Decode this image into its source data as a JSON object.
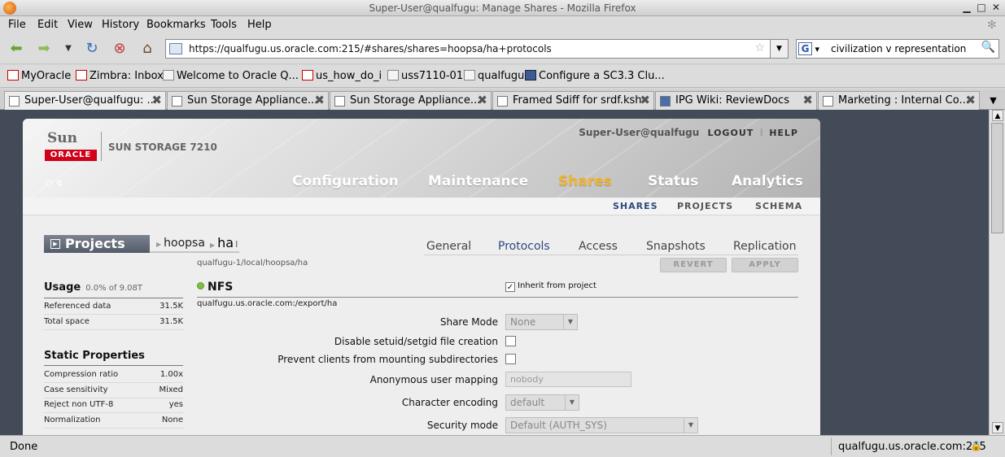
{
  "window": {
    "title": "Super-User@qualfugu: Manage Shares - Mozilla Firefox"
  },
  "menu": [
    "File",
    "Edit",
    "View",
    "History",
    "Bookmarks",
    "Tools",
    "Help"
  ],
  "nav": {
    "url": "https://qualfugu.us.oracle.com:215/#shares/shares=hoopsa/ha+protocols",
    "search_value": "civilization v representation",
    "search_engine": "G"
  },
  "bookmarks": [
    "MyOracle",
    "Zimbra: Inbox",
    "Welcome to Oracle Q...",
    "us_how_do_i",
    "uss7110-01",
    "qualfugu",
    "Configure a SC3.3 Clu..."
  ],
  "tabs": [
    "Super-User@qualfugu: ...",
    "Sun Storage Appliance...",
    "Sun Storage Appliance...",
    "Framed Sdiff for srdf.ksh",
    "IPG Wiki: ReviewDocs",
    "Marketing : Internal Co..."
  ],
  "status": {
    "left": "Done",
    "host": "qualfugu.us.oracle.com:215"
  },
  "app": {
    "logo_sun": "Sun",
    "logo_oracle": "ORACLE",
    "product": "SUN STORAGE 7210",
    "user": "Super-User@qualfugu",
    "logout": "LOGOUT",
    "help": "HELP",
    "main_nav": [
      "Configuration",
      "Maintenance",
      "Shares",
      "Status",
      "Analytics"
    ],
    "main_nav_selected": "Shares",
    "sub_nav": [
      "SHARES",
      "PROJECTS",
      "SCHEMA"
    ],
    "sub_nav_selected": "SHARES",
    "projects_label": "Projects",
    "breadcrumb": {
      "project": "hoopsa",
      "share": "ha"
    },
    "path": "qualfugu-1/local/hoopsa/ha",
    "page_tabs": [
      "General",
      "Protocols",
      "Access",
      "Snapshots",
      "Replication"
    ],
    "page_tab_selected": "Protocols",
    "buttons": {
      "revert": "REVERT",
      "apply": "APPLY"
    },
    "usage": {
      "title": "Usage",
      "summary": "0.0% of 9.08T",
      "rows": [
        {
          "label": "Referenced data",
          "value": "31.5K"
        },
        {
          "label": "Total space",
          "value": "31.5K"
        }
      ]
    },
    "static_props": {
      "title": "Static Properties",
      "rows": [
        {
          "label": "Compression ratio",
          "value": "1.00x"
        },
        {
          "label": "Case sensitivity",
          "value": "Mixed"
        },
        {
          "label": "Reject non UTF-8",
          "value": "yes"
        },
        {
          "label": "Normalization",
          "value": "None"
        }
      ]
    },
    "nfs": {
      "title": "NFS",
      "inherit_label": "Inherit from project",
      "inherit_checked": true,
      "export_path": "qualfugu.us.oracle.com:/export/ha",
      "fields": {
        "share_mode": {
          "label": "Share Mode",
          "value": "None"
        },
        "disable_setuid": {
          "label": "Disable setuid/setgid file creation"
        },
        "prevent_mount": {
          "label": "Prevent clients from mounting subdirectories"
        },
        "anon_mapping": {
          "label": "Anonymous user mapping",
          "value": "nobody"
        },
        "char_encoding": {
          "label": "Character encoding",
          "value": "default"
        },
        "security_mode": {
          "label": "Security mode",
          "value": "Default (AUTH_SYS)"
        }
      }
    }
  },
  "colors": {
    "accent_selected": "#f2b530",
    "link_blue": "#2e4a7e",
    "page_bg": "#434b59",
    "oracle_red": "#d0021b"
  }
}
